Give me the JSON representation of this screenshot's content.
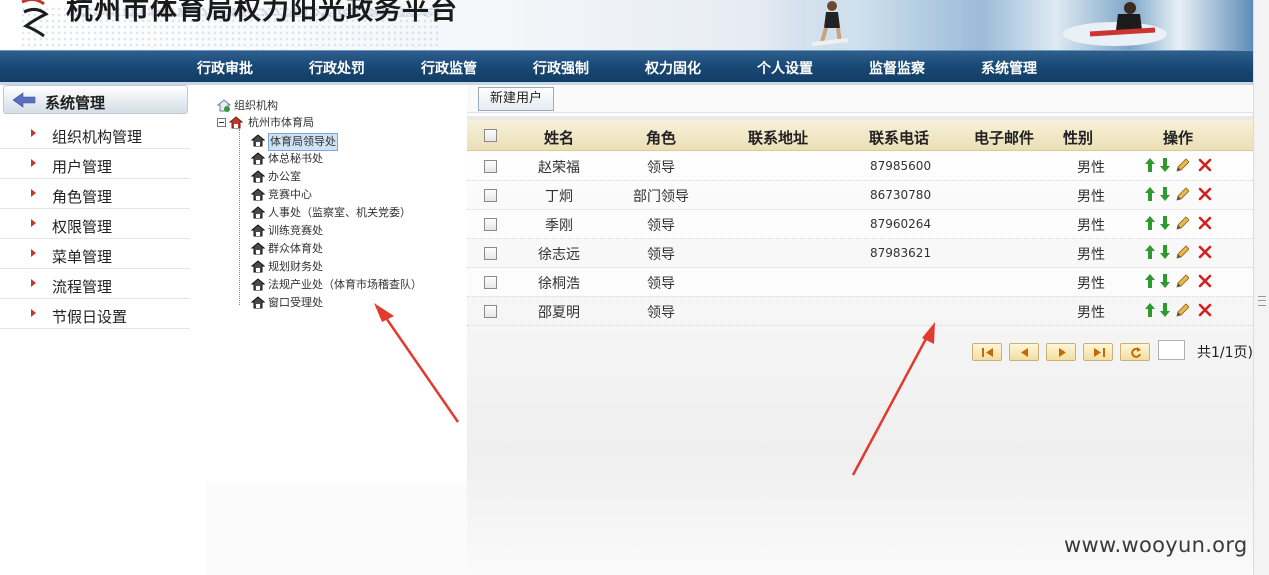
{
  "header": {
    "title": "杭州市体育局权力阳光政务平台"
  },
  "nav": {
    "items": [
      "行政审批",
      "行政处罚",
      "行政监管",
      "行政强制",
      "权力固化",
      "个人设置",
      "监督监察",
      "系统管理"
    ]
  },
  "sidebar": {
    "title": "系统管理",
    "items": [
      "组织机构管理",
      "用户管理",
      "角色管理",
      "权限管理",
      "菜单管理",
      "流程管理",
      "节假日设置"
    ]
  },
  "tree": {
    "root": "组织机构",
    "org": "杭州市体育局",
    "children": [
      "体育局领导处",
      "体总秘书处",
      "办公室",
      "竞赛中心",
      "人事处（监察室、机关党委）",
      "训练竞赛处",
      "群众体育处",
      "规划财务处",
      "法规产业处（体育市场稽查队）",
      "窗口受理处"
    ],
    "selected_index": 0
  },
  "toolbar": {
    "new_user": "新建用户"
  },
  "table": {
    "columns": [
      "姓名",
      "角色",
      "联系地址",
      "联系电话",
      "电子邮件",
      "性别",
      "操作"
    ],
    "rows": [
      {
        "name": "赵荣福",
        "role": "领导",
        "address": "",
        "phone": "87985600",
        "email": "",
        "gender": "男性"
      },
      {
        "name": "丁炯",
        "role": "部门领导",
        "address": "",
        "phone": "86730780",
        "email": "",
        "gender": "男性"
      },
      {
        "name": "季刚",
        "role": "领导",
        "address": "",
        "phone": "87960264",
        "email": "",
        "gender": "男性"
      },
      {
        "name": "徐志远",
        "role": "领导",
        "address": "",
        "phone": "87983621",
        "email": "",
        "gender": "男性"
      },
      {
        "name": "徐桐浩",
        "role": "领导",
        "address": "",
        "phone": "",
        "email": "",
        "gender": "男性"
      },
      {
        "name": "邵夏明",
        "role": "领导",
        "address": "",
        "phone": "",
        "email": "",
        "gender": "男性"
      }
    ]
  },
  "pager": {
    "page_input": "",
    "total_text": "共1/1页)"
  },
  "watermark": "www.wooyun.org",
  "colors": {
    "nav_bg": "#1a4a77",
    "grid_header": "#ebdfb6",
    "annotation_arrow": "#e23a2f",
    "action_up_down": "#2e9a2e",
    "action_delete": "#d42020"
  },
  "icons": {
    "action_up": "arrow-up-icon",
    "action_down": "arrow-down-icon",
    "action_edit": "pencil-icon",
    "action_delete": "delete-x-icon"
  }
}
